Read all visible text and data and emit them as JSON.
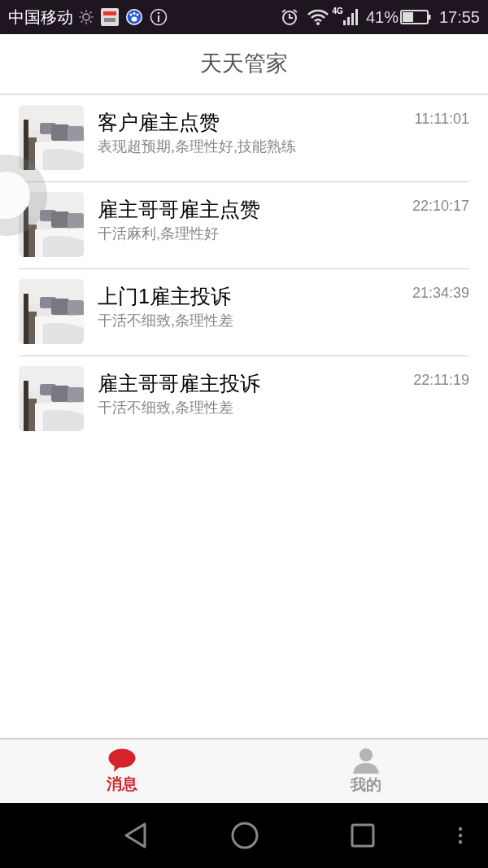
{
  "status_bar": {
    "carrier": "中国移动",
    "battery": "41%",
    "network": "4G",
    "time": "17:55"
  },
  "header": {
    "title": "天天管家"
  },
  "messages": [
    {
      "title": "客户雇主点赞",
      "subtitle": "表现超预期,条理性好,技能熟练",
      "time": "11:11:01"
    },
    {
      "title": "雇主哥哥雇主点赞",
      "subtitle": "干活麻利,条理性好",
      "time": "22:10:17"
    },
    {
      "title": "上门1雇主投诉",
      "subtitle": "干活不细致,条理性差",
      "time": "21:34:39"
    },
    {
      "title": "雇主哥哥雇主投诉",
      "subtitle": "干活不细致,条理性差",
      "time": "22:11:19"
    }
  ],
  "tabs": [
    {
      "label": "消息",
      "kind": "chat",
      "selected": true
    },
    {
      "label": "我的",
      "kind": "person",
      "selected": false
    }
  ]
}
